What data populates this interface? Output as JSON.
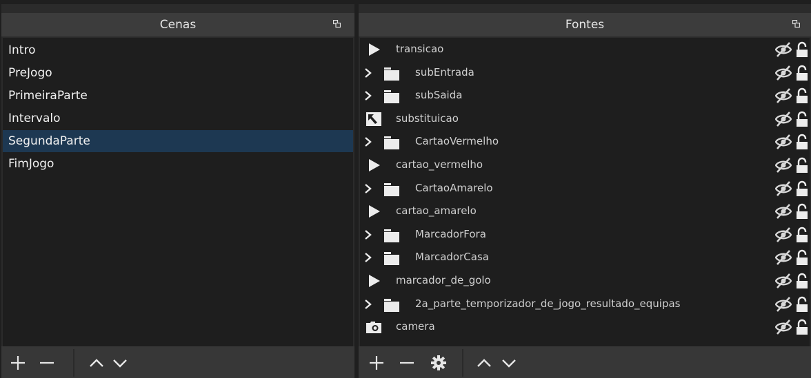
{
  "scenes": {
    "title": "Cenas",
    "items": [
      {
        "label": "Intro"
      },
      {
        "label": "PreJogo"
      },
      {
        "label": "PrimeiraParte"
      },
      {
        "label": "Intervalo"
      },
      {
        "label": "SegundaParte",
        "selected": true
      },
      {
        "label": "FimJogo"
      }
    ],
    "footer": [
      "add-icon",
      "remove-icon",
      "move-up-icon",
      "move-down-icon"
    ]
  },
  "sources": {
    "title": "Fontes",
    "items": [
      {
        "label": "transicao",
        "type": "media",
        "expandable": false
      },
      {
        "label": "subEntrada",
        "type": "group",
        "expandable": true
      },
      {
        "label": "subSaida",
        "type": "group",
        "expandable": true
      },
      {
        "label": "substituicao",
        "type": "image",
        "expandable": false
      },
      {
        "label": "CartaoVermelho",
        "type": "group",
        "expandable": true
      },
      {
        "label": "cartao_vermelho",
        "type": "media",
        "expandable": false
      },
      {
        "label": "CartaoAmarelo",
        "type": "group",
        "expandable": true
      },
      {
        "label": "cartao_amarelo",
        "type": "media",
        "expandable": false
      },
      {
        "label": "MarcadorFora",
        "type": "group",
        "expandable": true
      },
      {
        "label": "MarcadorCasa",
        "type": "group",
        "expandable": true
      },
      {
        "label": "marcador_de_golo",
        "type": "media",
        "expandable": false
      },
      {
        "label": "2a_parte_temporizador_de_jogo_resultado_equipas",
        "type": "group",
        "expandable": true
      },
      {
        "label": "camera",
        "type": "camera",
        "expandable": false
      }
    ],
    "footer": [
      "add-icon",
      "remove-icon",
      "gear-icon",
      "move-up-icon",
      "move-down-icon"
    ]
  },
  "colors": {
    "panel_title_bg": "#3c3c3c",
    "list_bg": "#1e1e1e",
    "selected_bg": "#1d3852",
    "footer_bg": "#373737"
  }
}
